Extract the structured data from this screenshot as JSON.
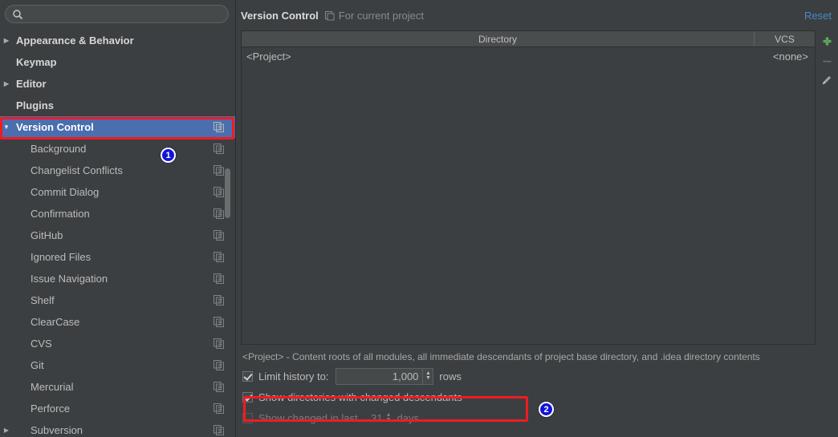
{
  "search": {
    "value": "",
    "placeholder": ""
  },
  "sidebar": {
    "items": [
      {
        "label": "Appearance & Behavior",
        "arrow": "collapsed",
        "level": 0,
        "bold": true,
        "selected": false,
        "copy_icon": false
      },
      {
        "label": "Keymap",
        "arrow": "none",
        "level": 0,
        "bold": true,
        "selected": false,
        "copy_icon": false
      },
      {
        "label": "Editor",
        "arrow": "collapsed",
        "level": 0,
        "bold": true,
        "selected": false,
        "copy_icon": false
      },
      {
        "label": "Plugins",
        "arrow": "none",
        "level": 0,
        "bold": true,
        "selected": false,
        "copy_icon": false
      },
      {
        "label": "Version Control",
        "arrow": "expanded",
        "level": 0,
        "bold": true,
        "selected": true,
        "copy_icon": true
      },
      {
        "label": "Background",
        "arrow": "none",
        "level": 1,
        "bold": false,
        "selected": false,
        "copy_icon": true
      },
      {
        "label": "Changelist Conflicts",
        "arrow": "none",
        "level": 1,
        "bold": false,
        "selected": false,
        "copy_icon": true
      },
      {
        "label": "Commit Dialog",
        "arrow": "none",
        "level": 1,
        "bold": false,
        "selected": false,
        "copy_icon": true
      },
      {
        "label": "Confirmation",
        "arrow": "none",
        "level": 1,
        "bold": false,
        "selected": false,
        "copy_icon": true
      },
      {
        "label": "GitHub",
        "arrow": "none",
        "level": 1,
        "bold": false,
        "selected": false,
        "copy_icon": true
      },
      {
        "label": "Ignored Files",
        "arrow": "none",
        "level": 1,
        "bold": false,
        "selected": false,
        "copy_icon": true
      },
      {
        "label": "Issue Navigation",
        "arrow": "none",
        "level": 1,
        "bold": false,
        "selected": false,
        "copy_icon": true
      },
      {
        "label": "Shelf",
        "arrow": "none",
        "level": 1,
        "bold": false,
        "selected": false,
        "copy_icon": true
      },
      {
        "label": "ClearCase",
        "arrow": "none",
        "level": 1,
        "bold": false,
        "selected": false,
        "copy_icon": true
      },
      {
        "label": "CVS",
        "arrow": "none",
        "level": 1,
        "bold": false,
        "selected": false,
        "copy_icon": true
      },
      {
        "label": "Git",
        "arrow": "none",
        "level": 1,
        "bold": false,
        "selected": false,
        "copy_icon": true
      },
      {
        "label": "Mercurial",
        "arrow": "none",
        "level": 1,
        "bold": false,
        "selected": false,
        "copy_icon": true
      },
      {
        "label": "Perforce",
        "arrow": "none",
        "level": 1,
        "bold": false,
        "selected": false,
        "copy_icon": true
      },
      {
        "label": "Subversion",
        "arrow": "collapsed",
        "level": 1,
        "bold": false,
        "selected": false,
        "copy_icon": true
      }
    ]
  },
  "header": {
    "title": "Version Control",
    "scope": "For current project",
    "scope_icon": "copy-settings-icon",
    "reset_label": "Reset"
  },
  "table": {
    "columns": [
      "Directory",
      "VCS"
    ],
    "rows": [
      {
        "directory": "<Project>",
        "vcs": "<none>"
      }
    ]
  },
  "toolbar": {
    "add_label": "+",
    "remove_label": "–",
    "edit_label": "edit-pencil-icon"
  },
  "footer": {
    "hint": "<Project> - Content roots of all modules, all immediate descendants of project base directory, and .idea directory contents",
    "limit_history": {
      "label": "Limit history to:",
      "checked": true,
      "value": "1,000",
      "unit": "rows"
    },
    "show_directories": {
      "label": "Show directories with changed descendants",
      "checked": true
    },
    "show_changed": {
      "label_before": "Show changed in last",
      "value": "31",
      "label_after": "days",
      "checked": false,
      "enabled": false
    }
  },
  "annotations": {
    "badges": [
      {
        "number": "1"
      },
      {
        "number": "2"
      }
    ],
    "highlight_color": "#ee1c22",
    "badge_color": "#1313d8"
  }
}
